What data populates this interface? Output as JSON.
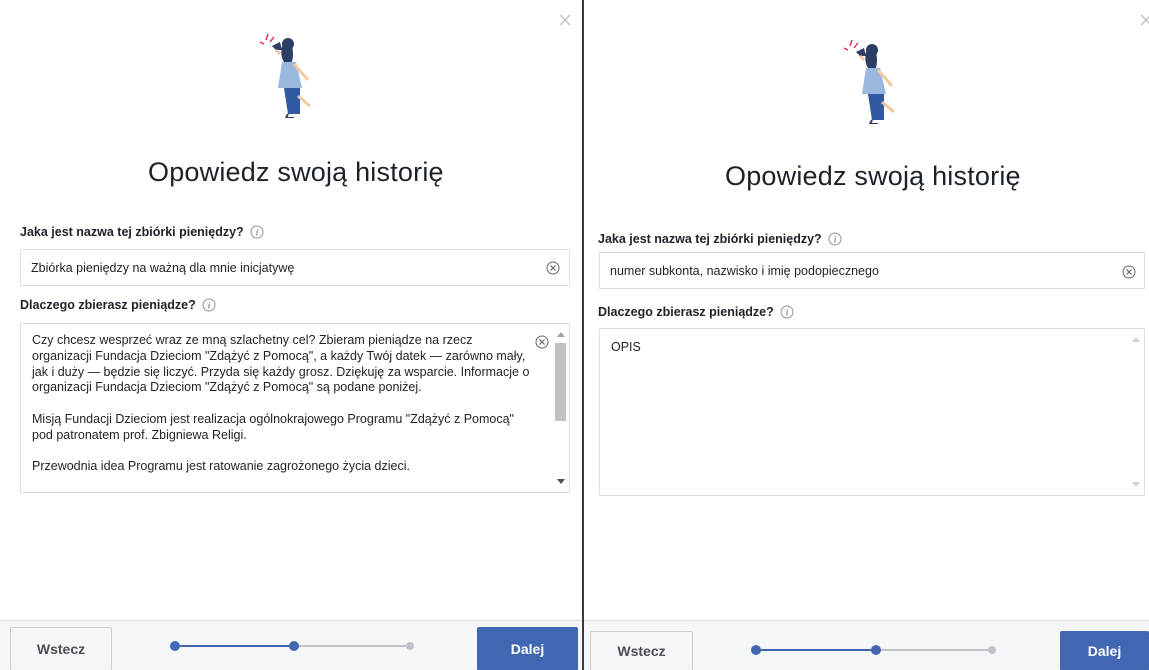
{
  "colors": {
    "accent": "#4267b2",
    "step_active": "#4267b2",
    "step_inactive": "#bec3c9",
    "text": "#1d2129",
    "border": "#dddfe2"
  },
  "icons": {
    "close": "close-icon",
    "info": "info-icon",
    "clear": "clear-icon",
    "illustration": "woman-megaphone-illustration"
  },
  "left_panel": {
    "title": "Opowiedz swoją historię",
    "name_label": "Jaka jest nazwa tej zbiórki pieniędzy?",
    "name_value": "Zbiórka pieniędzy na ważną dla mnie inicjatywę",
    "reason_label": "Dlaczego zbierasz pieniądze?",
    "reason_paragraphs": [
      "Czy chcesz wesprzeć wraz ze mną szlachetny cel? Zbieram pieniądze na rzecz organizacji Fundacja Dzieciom \"Zdążyć z Pomocą\", a każdy Twój datek — zarówno mały, jak i duży — będzie się liczyć. Przyda się każdy grosz. Dziękuję za wsparcie. Informacje o organizacji Fundacja Dzieciom \"Zdążyć z Pomocą\" są podane poniżej.",
      "Misją Fundacji Dzieciom jest realizacja ogólnokrajowego Programu \"Zdążyć z Pomocą\" pod patronatem prof. Zbigniewa Religi.",
      "Przewodnia idea Programu jest ratowanie zagrożonego życia dzieci."
    ],
    "back_label": "Wstecz",
    "next_label": "Dalej",
    "step_current": 2,
    "step_total": 3
  },
  "right_panel": {
    "title": "Opowiedz swoją historię",
    "name_label": "Jaka jest nazwa tej zbiórki pieniędzy?",
    "name_value": "numer subkonta, nazwisko i imię podopiecznego",
    "reason_label": "Dlaczego zbierasz pieniądze?",
    "reason_value": "OPIS",
    "back_label": "Wstecz",
    "next_label": "Dalej",
    "step_current": 2,
    "step_total": 3
  }
}
